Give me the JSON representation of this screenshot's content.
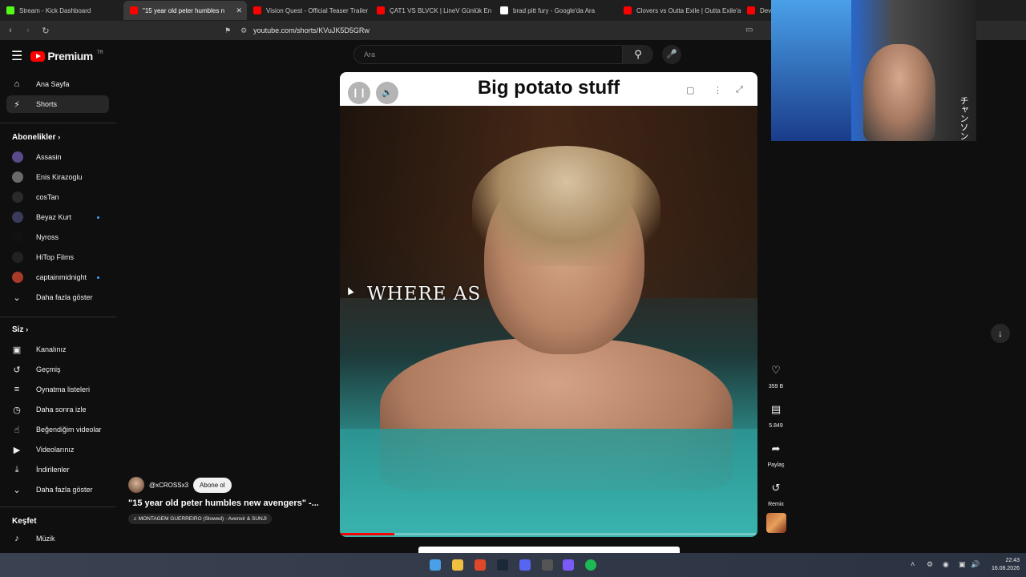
{
  "browser": {
    "tabs": [
      {
        "label": "Stream - Kick Dashboard",
        "color": "#53fc18"
      },
      {
        "label": "\"15 year old peter humbles n",
        "color": "#ff0000"
      },
      {
        "label": "Vision Quest - Official Teaser Trailer |",
        "color": "#ff0000"
      },
      {
        "label": "ÇAT1 VS BLVCK | LineV Günlük En Fa",
        "color": "#ff0000"
      },
      {
        "label": "brad pitt fury - Google'da Ara",
        "color": "#ffffff"
      },
      {
        "label": "Clovers vs Outta Exile | Outta Exile'a",
        "color": "#ff0000"
      },
      {
        "label": "Devi",
        "color": "#ff0000"
      }
    ],
    "url": "youtube.com/shorts/KVuJK5D5GRw"
  },
  "youtube": {
    "logo_text": "Premium",
    "region": "TR",
    "search_placeholder": "Ara"
  },
  "sidebar": {
    "main": [
      {
        "label": "Ana Sayfa",
        "icon": "home-icon"
      },
      {
        "label": "Shorts",
        "icon": "shorts-icon",
        "active": true
      }
    ],
    "subscriptions_title": "Abonelikler",
    "subscriptions": [
      {
        "label": "Assasin",
        "color": "#5a4a8a",
        "dot": false
      },
      {
        "label": "Enis Kirazoglu",
        "color": "#6a6a6a",
        "dot": false
      },
      {
        "label": "cosTan",
        "color": "#2a2a2a",
        "dot": false
      },
      {
        "label": "Beyaz Kurt",
        "color": "#3a3a5a",
        "dot": true
      },
      {
        "label": "Nyross",
        "color": "#111111",
        "dot": false
      },
      {
        "label": "HiTop Films",
        "color": "#222222",
        "dot": false
      },
      {
        "label": "captainmidnight",
        "color": "#a83a2a",
        "dot": true
      }
    ],
    "subscriptions_more": "Daha fazla göster",
    "you_title": "Siz",
    "you": [
      {
        "label": "Kanalınız",
        "icon": "channel-icon"
      },
      {
        "label": "Geçmiş",
        "icon": "history-icon"
      },
      {
        "label": "Oynatma listeleri",
        "icon": "playlist-icon"
      },
      {
        "label": "Daha sonra izle",
        "icon": "clock-icon"
      },
      {
        "label": "Beğendiğim videolar",
        "icon": "like-icon"
      },
      {
        "label": "Videolarınız",
        "icon": "video-icon"
      },
      {
        "label": "İndirilenler",
        "icon": "download-icon"
      }
    ],
    "you_more": "Daha fazla göster",
    "explore_title": "Keşfet",
    "explore": [
      {
        "label": "Müzik",
        "icon": "music-icon"
      }
    ]
  },
  "short": {
    "top_title": "Big potato stuff",
    "overlay_text": "WHERE AS",
    "progress": 0.13,
    "channel": "@xCROSSx3",
    "subscribe_label": "Abone ol",
    "title": "\"15 year old peter humbles new avengers\" -...",
    "music": "MONTAGEM GUERREIRO (Slowed) · Avenxir & SUNJI"
  },
  "actions": {
    "likes": "359 B",
    "comments": "5.849",
    "share": "Paylaş",
    "remix": "Remix"
  },
  "overlay": {
    "webcam_text": "チャンソン"
  },
  "taskbar": {
    "time": "22:43",
    "date": "16.08.2026"
  }
}
